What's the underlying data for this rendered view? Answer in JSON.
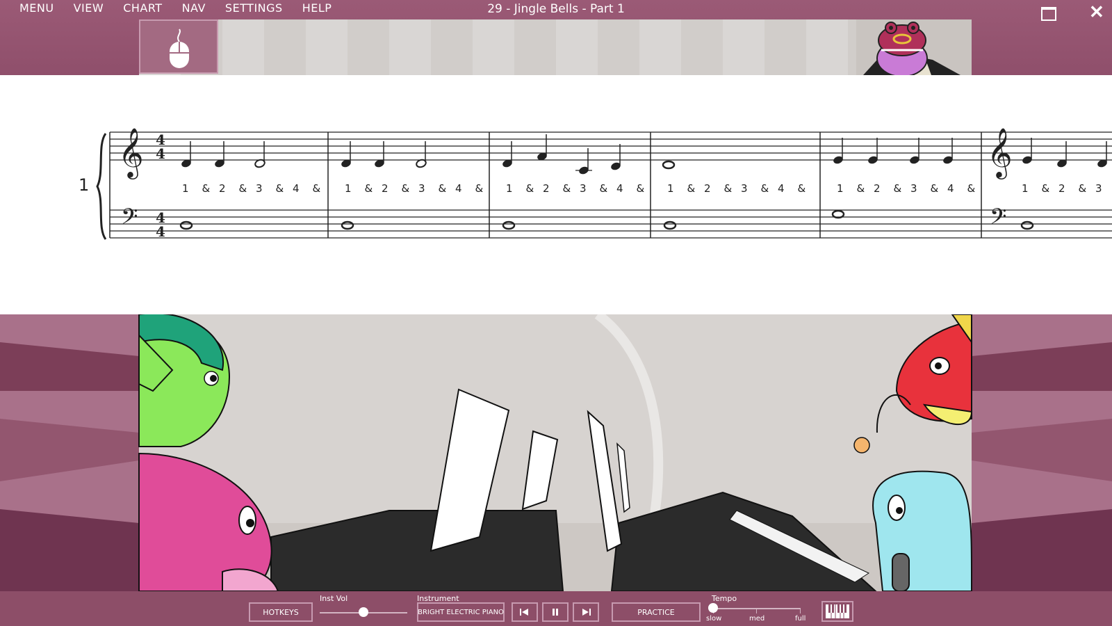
{
  "menu": [
    "MENU",
    "VIEW",
    "CHART",
    "NAV",
    "SETTINGS",
    "HELP"
  ],
  "title": "29 - Jingle Bells - Part 1",
  "sheet": {
    "system_number": "1",
    "time_signature": [
      "4",
      "4"
    ],
    "count_labels": [
      "1",
      "&",
      "2",
      "&",
      "3",
      "&",
      "4",
      "&"
    ]
  },
  "toolbar": {
    "hotkeys_label": "HOTKEYS",
    "inst_vol_label": "Inst Vol",
    "inst_vol_level": 0.5,
    "instrument_label": "Instrument",
    "instrument_value": "BRIGHT ELECTRIC PIANO",
    "practice_label": "PRACTICE",
    "tempo_label": "Tempo",
    "tempo_ticks": [
      "slow",
      "med",
      "full"
    ],
    "tempo_level": 0
  },
  "colors": {
    "frame": "#8d4e68",
    "accent_light": "#c79ab0"
  },
  "icons": [
    "mouse-icon",
    "maximize-icon",
    "close-icon",
    "skip-back-icon",
    "pause-icon",
    "skip-forward-icon",
    "piano-keyboard-icon"
  ]
}
